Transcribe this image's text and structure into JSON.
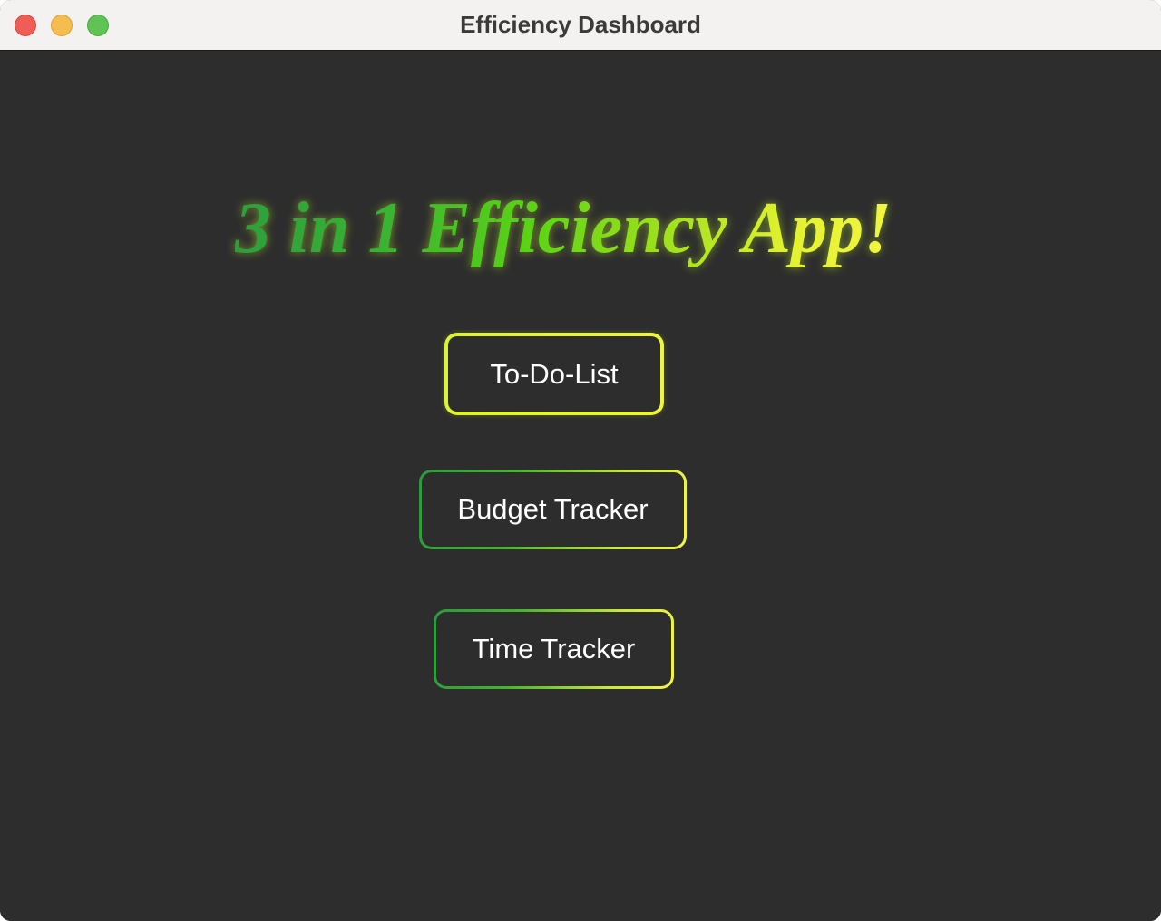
{
  "window": {
    "title": "Efficiency Dashboard"
  },
  "main": {
    "headline": "3 in 1 Efficiency App!",
    "buttons": {
      "todo": "To-Do-List",
      "budget": "Budget Tracker",
      "time": "Time Tracker"
    }
  },
  "colors": {
    "background": "#2d2d2d",
    "accent_green": "#2e9e3d",
    "accent_yellow": "#f2f540",
    "button_text": "#ffffff"
  }
}
